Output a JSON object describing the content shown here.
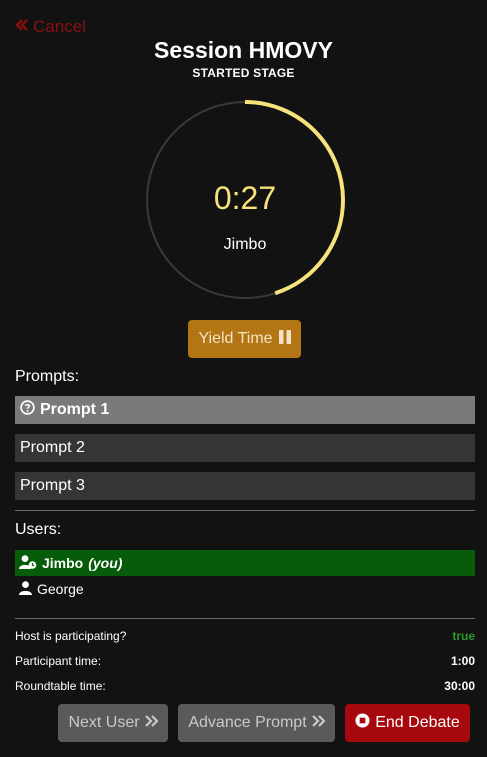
{
  "header": {
    "cancel_label": "Cancel",
    "title": "Session HMOVY",
    "subtitle": "STARTED STAGE"
  },
  "timer": {
    "value": "0:27",
    "speaker": "Jimbo",
    "progress_fraction": 0.45,
    "ring_color": "#f7e27c",
    "track_color": "#3a3a3a"
  },
  "yield_button": {
    "label": "Yield Time",
    "icon": "pause-icon"
  },
  "prompts": {
    "label": "Prompts:",
    "items": [
      {
        "label": "Prompt 1",
        "active": true,
        "icon": "question-circle-icon"
      },
      {
        "label": "Prompt 2",
        "active": false
      },
      {
        "label": "Prompt 3",
        "active": false
      }
    ]
  },
  "users": {
    "label": "Users:",
    "items": [
      {
        "name": "Jimbo",
        "suffix": "(you)",
        "current": true,
        "icon": "user-clock-icon"
      },
      {
        "name": "George",
        "suffix": "",
        "current": false,
        "icon": "user-icon"
      }
    ]
  },
  "info": {
    "host_label": "Host is participating?",
    "host_value": "true",
    "participant_label": "Participant time:",
    "participant_value": "1:00",
    "roundtable_label": "Roundtable time:",
    "roundtable_value": "30:00"
  },
  "actions": {
    "next_user": "Next User",
    "advance_prompt": "Advance Prompt",
    "end_debate": "End Debate"
  }
}
